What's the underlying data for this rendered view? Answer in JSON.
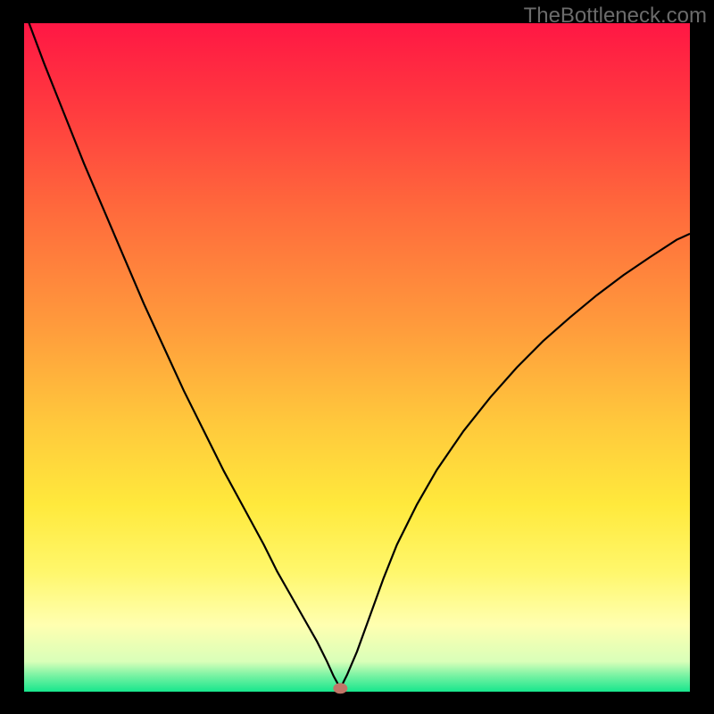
{
  "watermark": "TheBottleneck.com",
  "chart_data": {
    "type": "line",
    "title": "",
    "xlabel": "",
    "ylabel": "",
    "xlim": [
      0,
      100
    ],
    "ylim": [
      0,
      100
    ],
    "marker": {
      "x": 47.5,
      "y": 0.5,
      "color": "#c07668"
    },
    "gradient_stops": [
      {
        "offset": 0.0,
        "color": "#ff1744"
      },
      {
        "offset": 0.13,
        "color": "#ff3b3f"
      },
      {
        "offset": 0.28,
        "color": "#ff6a3c"
      },
      {
        "offset": 0.45,
        "color": "#ff9a3c"
      },
      {
        "offset": 0.6,
        "color": "#ffc93c"
      },
      {
        "offset": 0.72,
        "color": "#ffe93c"
      },
      {
        "offset": 0.82,
        "color": "#fff76b"
      },
      {
        "offset": 0.9,
        "color": "#ffffb0"
      },
      {
        "offset": 0.955,
        "color": "#d9ffb9"
      },
      {
        "offset": 0.975,
        "color": "#7cf3a4"
      },
      {
        "offset": 1.0,
        "color": "#18e68d"
      }
    ],
    "series": [
      {
        "name": "bottleneck-curve",
        "x": [
          0,
          3,
          6,
          9,
          12,
          15,
          18,
          21,
          24,
          27,
          30,
          33,
          36,
          38,
          40,
          42,
          44,
          45.5,
          46.5,
          47.5,
          48.5,
          50,
          52,
          54,
          56,
          59,
          62,
          66,
          70,
          74,
          78,
          82,
          86,
          90,
          94,
          98,
          100
        ],
        "y": [
          102,
          94,
          86.5,
          79,
          72,
          65,
          58,
          51.5,
          45,
          39,
          33,
          27.5,
          22,
          18,
          14.5,
          11,
          7.5,
          4.5,
          2.3,
          0.5,
          2.5,
          6,
          11.5,
          17,
          22,
          28,
          33.2,
          39,
          44,
          48.5,
          52.5,
          56,
          59.3,
          62.3,
          65,
          67.6,
          68.5
        ]
      }
    ]
  }
}
